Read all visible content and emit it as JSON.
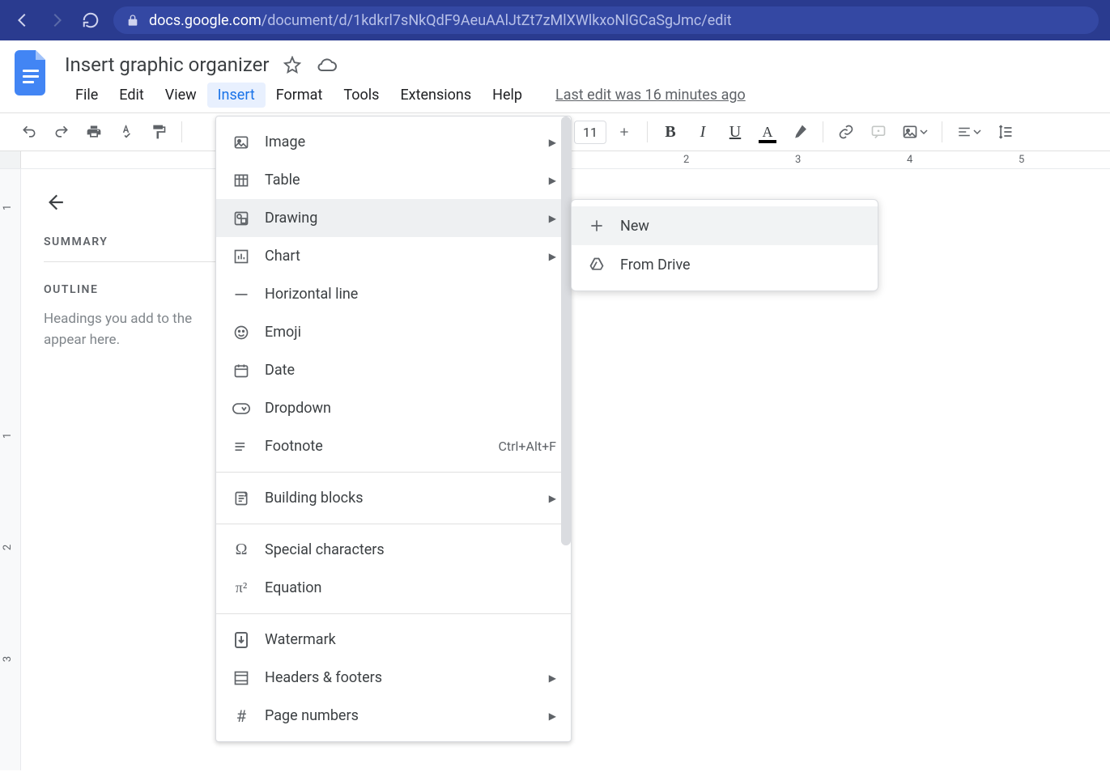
{
  "browser": {
    "url_domain": "docs.google.com",
    "url_path": "/document/d/1kdkrl7sNkQdF9AeuAAlJtZt7zMlXWlkxoNlGCaSgJmc/edit"
  },
  "doc": {
    "title": "Insert graphic organizer",
    "last_edit": "Last edit was 16 minutes ago"
  },
  "menus": {
    "file": "File",
    "edit": "Edit",
    "view": "View",
    "insert": "Insert",
    "format": "Format",
    "tools": "Tools",
    "extensions": "Extensions",
    "help": "Help"
  },
  "toolbar": {
    "font_size": "11"
  },
  "ruler": {
    "h": {
      "n2": "2",
      "n3": "3",
      "n4": "4",
      "n5": "5"
    },
    "v": {
      "n1a": "1",
      "n1b": "1",
      "n2": "2",
      "n3": "3"
    }
  },
  "sidebar": {
    "summary": "SUMMARY",
    "outline": "OUTLINE",
    "hint1": "Headings you add to the",
    "hint2": "appear here."
  },
  "insert_menu": {
    "image": "Image",
    "table": "Table",
    "drawing": "Drawing",
    "chart": "Chart",
    "hline": "Horizontal line",
    "emoji": "Emoji",
    "date": "Date",
    "dropdown": "Dropdown",
    "footnote": "Footnote",
    "footnote_sc": "Ctrl+Alt+F",
    "building": "Building blocks",
    "special": "Special characters",
    "equation": "Equation",
    "watermark": "Watermark",
    "headers_footers": "Headers & footers",
    "page_numbers": "Page numbers"
  },
  "submenu": {
    "new": "New",
    "from_drive": "From Drive"
  }
}
